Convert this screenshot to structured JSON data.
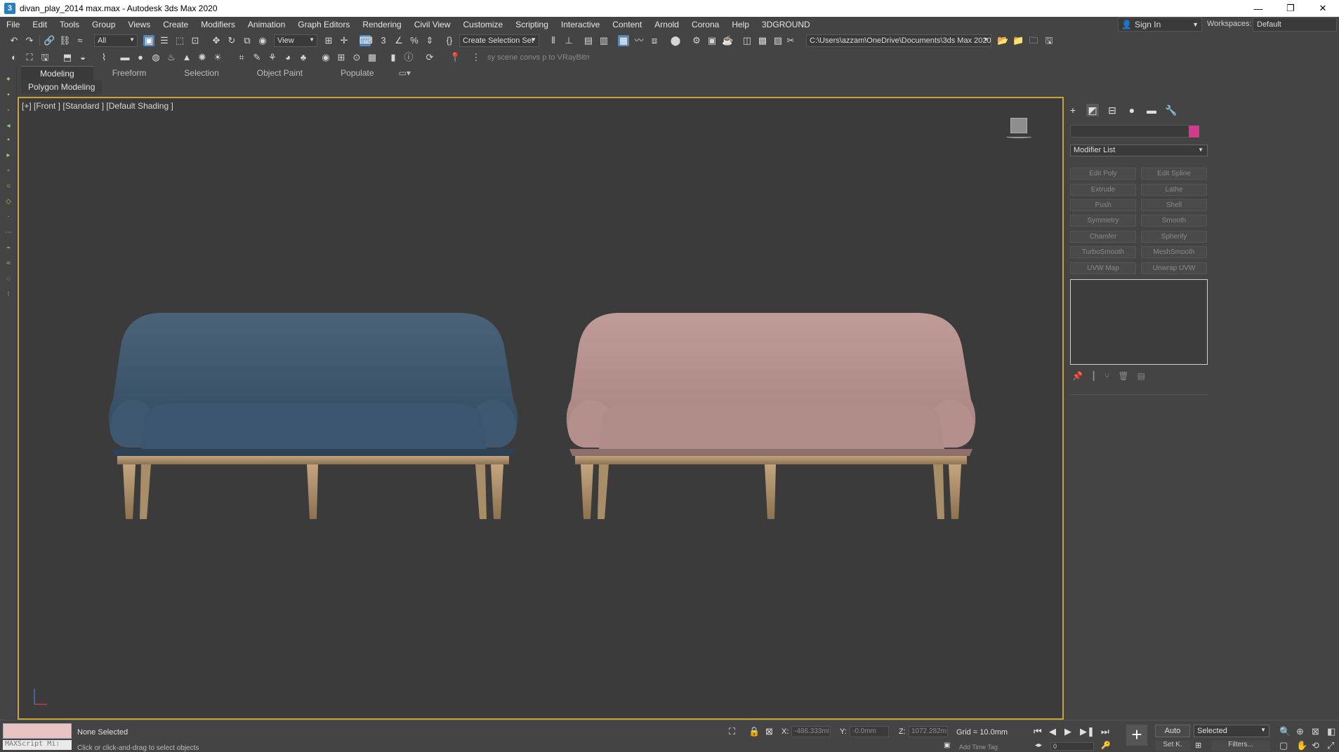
{
  "titlebar": {
    "title": "divan_play_2014 max.max - Autodesk 3ds Max 2020",
    "app_icon": "3",
    "minimize": "—",
    "restore": "❐",
    "close": "✕"
  },
  "menubar": {
    "items": [
      "File",
      "Edit",
      "Tools",
      "Group",
      "Views",
      "Create",
      "Modifiers",
      "Animation",
      "Graph Editors",
      "Rendering",
      "Civil View",
      "Customize",
      "Scripting",
      "Interactive",
      "Content",
      "Arnold",
      "Corona",
      "Help",
      "3DGROUND"
    ],
    "signin": "Sign In",
    "workspaces_label": "Workspaces:",
    "workspaces_value": "Default"
  },
  "toolbar1": {
    "filter": "All",
    "view": "View",
    "selection_set": "Create Selection Set",
    "path": "C:\\Users\\azzam\\OneDrive\\Documents\\3ds Max 2020"
  },
  "toolbar2": {
    "hint": "sy scene convs p to VRayBitm"
  },
  "ribbon": {
    "tabs": [
      "Modeling",
      "Freeform",
      "Selection",
      "Object Paint",
      "Populate"
    ],
    "sub": "Polygon Modeling"
  },
  "viewport": {
    "label": "[+] [Front ] [Standard ] [Default Shading ]"
  },
  "command_panel": {
    "modifier_list": "Modifier List",
    "buttons": [
      "Edit Poly",
      "Edit Spline",
      "Extrude",
      "Lathe",
      "Push",
      "Shell",
      "Symmetry",
      "Smooth",
      "Chamfer",
      "Spherify",
      "TurboSmooth",
      "MeshSmooth",
      "UVW Map",
      "Unwrap UVW"
    ],
    "swatch_color": "#d13b8b"
  },
  "status": {
    "maxscript_label": "MAXScript Mi:",
    "selection": "None Selected",
    "hint": "Click or click-and-drag to select objects",
    "x_label": "X:",
    "x_value": "-486.333mi",
    "y_label": "Y:",
    "y_value": "-0.0mm",
    "z_label": "Z:",
    "z_value": "1072.282m",
    "grid": "Grid = 10.0mm",
    "auto": "Auto",
    "selected": "Selected",
    "setk": "Set K.",
    "filters": "Filters...",
    "frame": "0",
    "add_time_tag": "Add Time Tag"
  },
  "colors": {
    "sofa_left": "#3d5870",
    "sofa_right": "#b8908c",
    "legs": "#a88e68",
    "viewport_border": "#c9a23c"
  }
}
